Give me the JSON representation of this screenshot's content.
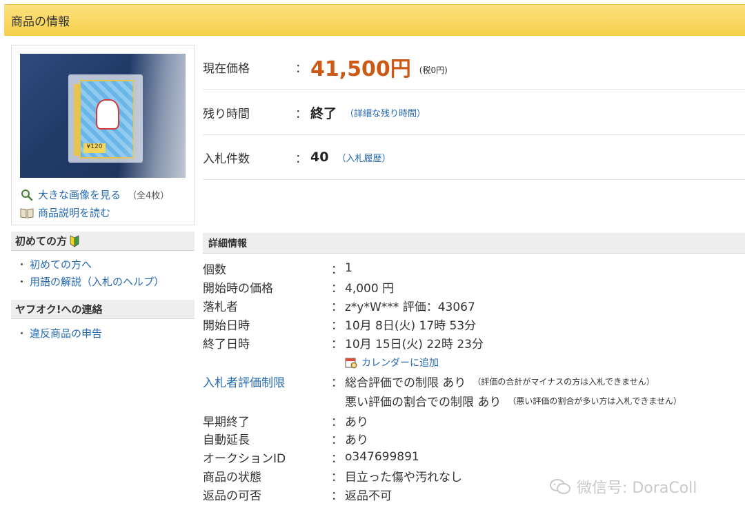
{
  "section_title": "商品の情報",
  "product": {
    "card_number": "¥120",
    "links": {
      "view_large": "大きな画像を見る",
      "image_count": "（全4枚）",
      "read_description": "商品説明を読む"
    }
  },
  "sidebar": {
    "beginners_heading": "初めての方",
    "beginners_links": [
      "初めての方へ",
      "用語の解説（入札のヘルプ）"
    ],
    "contact_heading": "ヤフオク!への連絡",
    "contact_links": [
      "違反商品の申告"
    ]
  },
  "summary": {
    "price_label": "現在価格",
    "price_value": "41,500円",
    "tax_note": "(税0円)",
    "time_label": "残り時間",
    "time_value": "終了",
    "time_link": "（詳細な残り時間）",
    "bids_label": "入札件数",
    "bids_value": "40",
    "bids_link": "（入札履歴）",
    "colon": "："
  },
  "detail": {
    "heading": "詳細情報",
    "quantity_label": "個数",
    "quantity_value": "1",
    "start_price_label": "開始時の価格",
    "start_price_value": "4,000 円",
    "winner_label": "落札者",
    "winner_value": "z*y*W*** 評価：43067",
    "start_date_label": "開始日時",
    "start_date_value": "10月 8日(火) 17時 53分",
    "end_date_label": "終了日時",
    "end_date_value": "10月 15日(火) 22時 23分",
    "calendar_link": "カレンダーに追加",
    "restriction_label": "入札者評価制限",
    "restriction_1": "総合評価での制限 あり",
    "restriction_1_note": "（評価の合計がマイナスの方は入札できません）",
    "restriction_2": "悪い評価の割合での制限 あり",
    "restriction_2_note": "（悪い評価の割合が多い方は入札できません）",
    "early_end_label": "早期終了",
    "early_end_value": "あり",
    "auto_extend_label": "自動延長",
    "auto_extend_value": "あり",
    "auction_id_label": "オークションID",
    "auction_id_value": "o347699891",
    "condition_label": "商品の状態",
    "condition_value": "目立った傷や汚れなし",
    "returns_label": "返品の可否",
    "returns_value": "返品不可"
  },
  "watermark": "微信号: DoraColl",
  "colors": {
    "price": "#cc5a14",
    "link": "#2469b2",
    "header_bg": "#f6cf4a"
  }
}
